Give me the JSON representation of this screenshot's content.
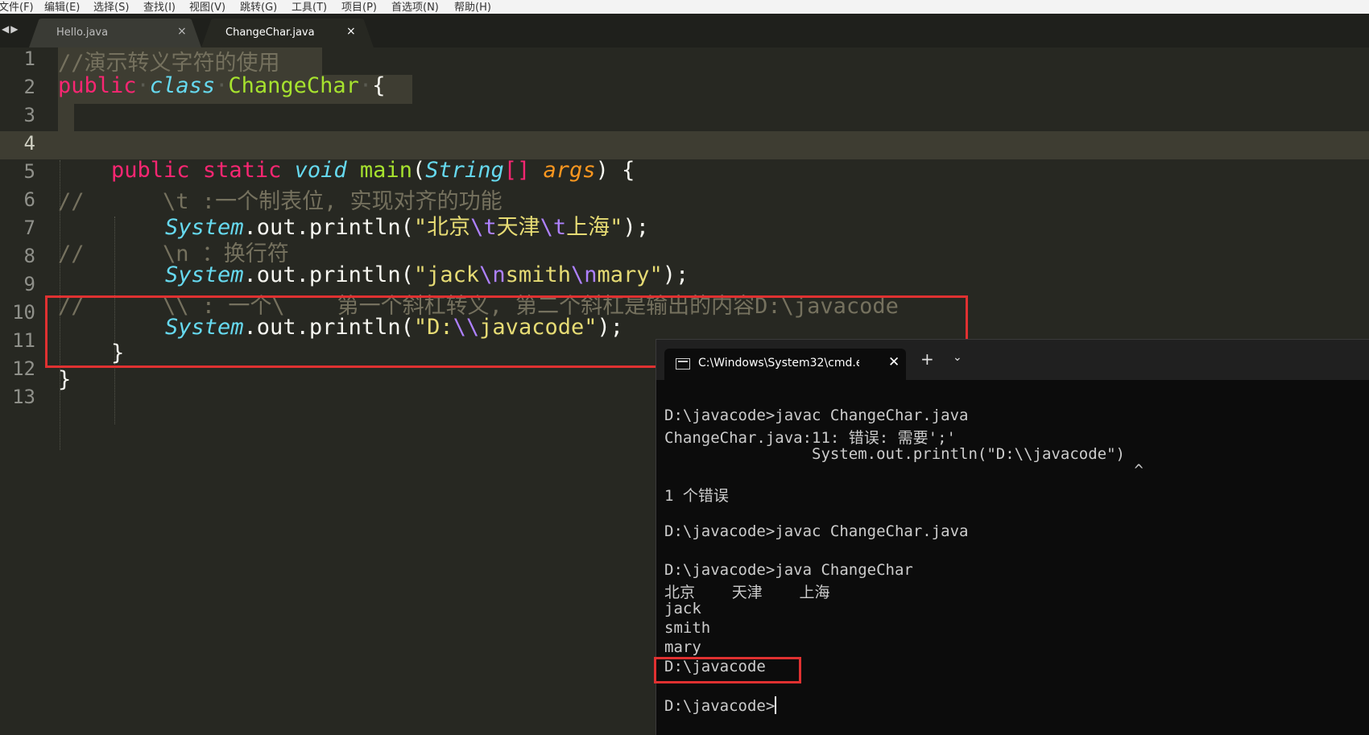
{
  "menu": [
    "文件(F)",
    "编辑(E)",
    "选择(S)",
    "查找(I)",
    "视图(V)",
    "跳转(G)",
    "工具(T)",
    "项目(P)",
    "首选项(N)",
    "帮助(H)"
  ],
  "tabs": [
    {
      "label": "Hello.java",
      "active": false
    },
    {
      "label": "ChangeChar.java",
      "active": true
    }
  ],
  "editor": {
    "line_numbers": [
      "1",
      "2",
      "3",
      "4",
      "5",
      "6",
      "7",
      "8",
      "9",
      "10",
      "11",
      "12",
      "13"
    ],
    "active_line": "4",
    "tokens": {
      "l1": "//演示转义字符的使用",
      "l2_public": "public",
      "l2_class": "class",
      "l2_name": "ChangeChar",
      "l2_brace": "{",
      "l5_public": "public",
      "l5_static": "static",
      "l5_void": "void",
      "l5_main": "main",
      "l5_string": "String",
      "l5_brackets": "[]",
      "l5_args": "args",
      "l6": "//      \\t :一个制表位, 实现对齐的功能",
      "l7_system": "System",
      "l7_rest": ".out.println(",
      "l7_s1": "\"北京",
      "l7_e1": "\\t",
      "l7_s2": "天津",
      "l7_e2": "\\t",
      "l7_s3": "上海\"",
      "l7_end": ");",
      "l8": "//      \\n ：换行符",
      "l9_system": "System",
      "l9_rest": ".out.println(",
      "l9_s1": "\"jack",
      "l9_e1": "\\n",
      "l9_s2": "smith",
      "l9_e2": "\\n",
      "l9_s3": "mary\"",
      "l9_end": ");",
      "l10": "//      \\\\ : 一个\\    第一个斜杠转义, 第二个斜杠是输出的内容D:\\javacode",
      "l11_system": "System",
      "l11_rest": ".out.println(",
      "l11_s1": "\"D:",
      "l11_e1": "\\\\",
      "l11_s2": "javacode\"",
      "l11_end": ");",
      "l12": "}",
      "l13": "}"
    }
  },
  "terminal": {
    "tab_title": "C:\\Windows\\System32\\cmd.e",
    "close_glyph": "✕",
    "plus_glyph": "+",
    "chevron_glyph": "⌄",
    "lines": [
      "D:\\javacode>javac ChangeChar.java",
      "ChangeChar.java:11: 错误: 需要';'",
      "                System.out.println(\"D:\\\\javacode\")",
      "                                                   ^",
      "1 个错误",
      "D:\\javacode>javac ChangeChar.java",
      "D:\\javacode>java ChangeChar",
      "北京    天津    上海",
      "jack",
      "smith",
      "mary",
      "D:\\javacode",
      "D:\\javacode>"
    ]
  }
}
